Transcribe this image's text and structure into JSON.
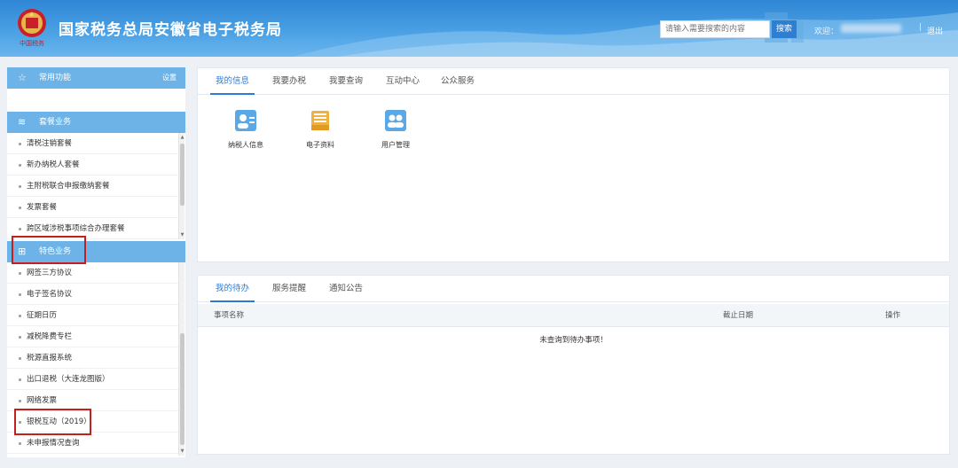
{
  "header": {
    "title": "国家税务总局安徽省电子税务局",
    "logo_text": "中国税务",
    "search_placeholder": "请输入需要搜索的内容",
    "search_button": "搜索",
    "welcome": "欢迎：",
    "separator": "|",
    "logout": "退出"
  },
  "sidebar": {
    "common": {
      "label": "常用功能",
      "setting": "设置"
    },
    "package": {
      "label": "套餐业务",
      "items": [
        "清税注销套餐",
        "新办纳税人套餐",
        "主附税联合申报缴纳套餐",
        "发票套餐",
        "跨区域涉税事项综合办理套餐"
      ]
    },
    "special": {
      "label": "特色业务",
      "items": [
        "网签三方协议",
        "电子签名协议",
        "征期日历",
        "减税降费专栏",
        "税源直报系统",
        "出口退税（大连龙图版）",
        "网络发票",
        "银税互动（2019）",
        "未申报情况查询"
      ]
    }
  },
  "top_panel": {
    "tabs": [
      "我的信息",
      "我要办税",
      "我要查询",
      "互动中心",
      "公众服务"
    ],
    "active_tab": 0,
    "apps": [
      {
        "label": "纳税人信息",
        "icon": "taxpayer-info-icon"
      },
      {
        "label": "电子资料",
        "icon": "electronic-docs-icon"
      },
      {
        "label": "用户管理",
        "icon": "user-management-icon"
      }
    ]
  },
  "bottom_panel": {
    "tabs": [
      "我的待办",
      "服务提醒",
      "通知公告"
    ],
    "active_tab": 0,
    "columns": [
      "事项名称",
      "截止日期",
      "操作"
    ],
    "empty_text": "未查询到待办事项！"
  },
  "colors": {
    "header_blue": "#3a92dc",
    "sidebar_head": "#6db3e8",
    "tab_active": "#2c7bd6",
    "highlight_red": "#c32020"
  }
}
